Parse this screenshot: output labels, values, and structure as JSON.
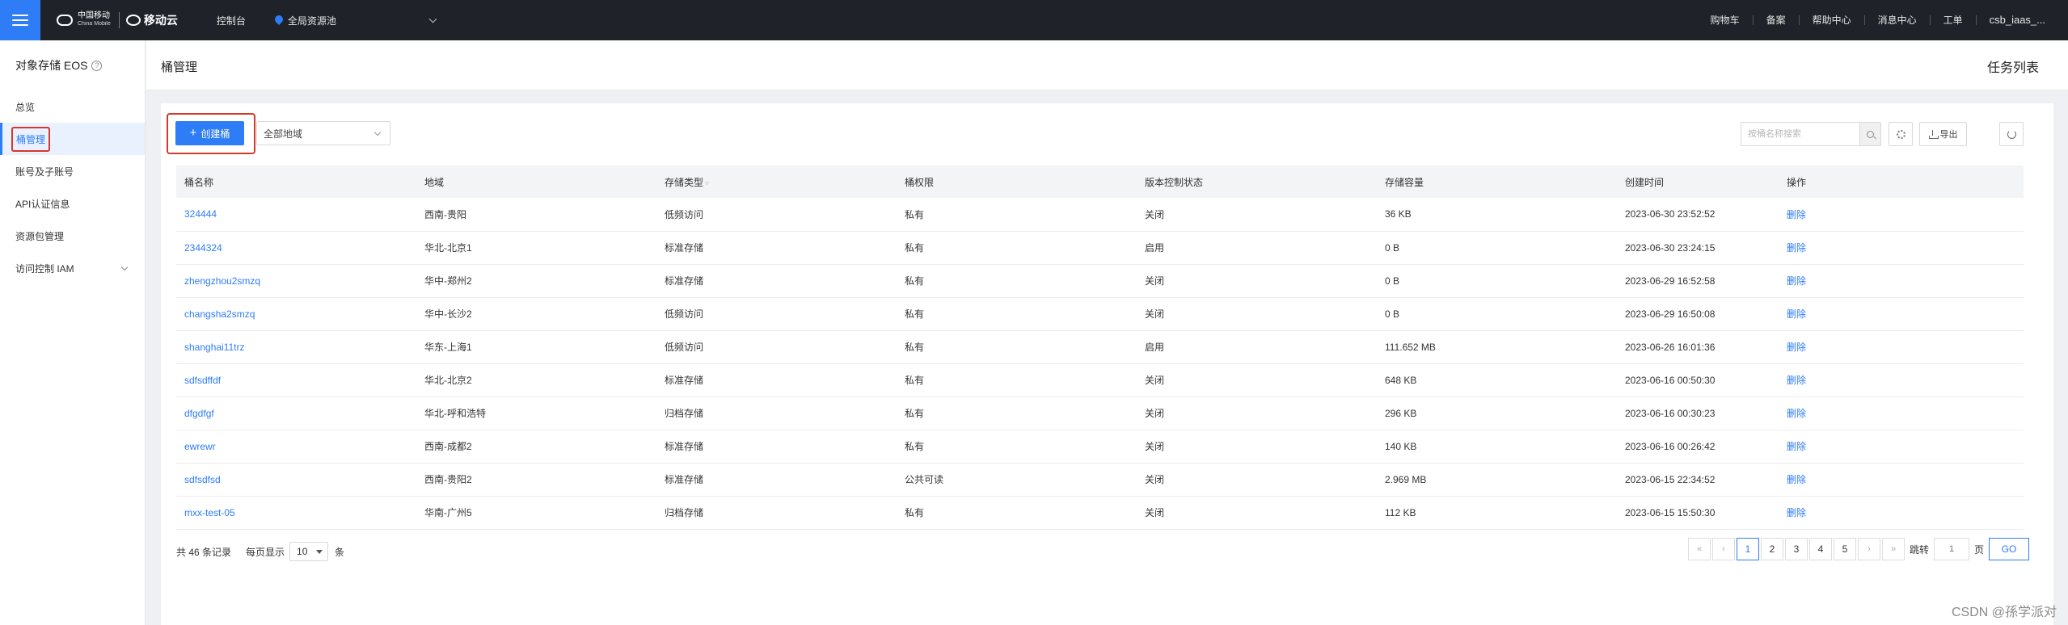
{
  "topbar": {
    "logo_cm": "中国移动",
    "logo_cm_en": "China Mobile",
    "logo_cloud": "移动云",
    "console": "控制台",
    "region": "全局资源池",
    "links": [
      "购物车",
      "备案",
      "帮助中心",
      "消息中心",
      "工单"
    ],
    "user": "csb_iaas_..."
  },
  "sidebar": {
    "title": "对象存储 EOS",
    "help": "?",
    "items": [
      {
        "label": "总览"
      },
      {
        "label": "桶管理"
      },
      {
        "label": "账号及子账号"
      },
      {
        "label": "API认证信息"
      },
      {
        "label": "资源包管理"
      },
      {
        "label": "访问控制 IAM"
      }
    ]
  },
  "header": {
    "title": "桶管理",
    "task_list": "任务列表"
  },
  "toolbar": {
    "create_plus": "+",
    "create_label": "创建桶",
    "region_filter": "全部地域",
    "search_placeholder": "按桶名称搜索",
    "export_label": "导出"
  },
  "table": {
    "columns": [
      "桶名称",
      "地域",
      "存储类型",
      "桶权限",
      "版本控制状态",
      "存储容量",
      "创建时间",
      "操作"
    ],
    "sort_marker": "÷",
    "rows": [
      {
        "name": "324444",
        "region": "西南-贵阳",
        "storage": "低频访问",
        "acl": "私有",
        "versioning": "关闭",
        "size": "36 KB",
        "created": "2023-06-30 23:52:52",
        "op": "删除"
      },
      {
        "name": "2344324",
        "region": "华北-北京1",
        "storage": "标准存储",
        "acl": "私有",
        "versioning": "启用",
        "size": "0 B",
        "created": "2023-06-30 23:24:15",
        "op": "删除"
      },
      {
        "name": "zhengzhou2smzq",
        "region": "华中-郑州2",
        "storage": "标准存储",
        "acl": "私有",
        "versioning": "关闭",
        "size": "0 B",
        "created": "2023-06-29 16:52:58",
        "op": "删除"
      },
      {
        "name": "changsha2smzq",
        "region": "华中-长沙2",
        "storage": "低频访问",
        "acl": "私有",
        "versioning": "关闭",
        "size": "0 B",
        "created": "2023-06-29 16:50:08",
        "op": "删除"
      },
      {
        "name": "shanghai11trz",
        "region": "华东-上海1",
        "storage": "低频访问",
        "acl": "私有",
        "versioning": "启用",
        "size": "111.652 MB",
        "created": "2023-06-26 16:01:36",
        "op": "删除"
      },
      {
        "name": "sdfsdffdf",
        "region": "华北-北京2",
        "storage": "标准存储",
        "acl": "私有",
        "versioning": "关闭",
        "size": "648 KB",
        "created": "2023-06-16 00:50:30",
        "op": "删除"
      },
      {
        "name": "dfgdfgf",
        "region": "华北-呼和浩特",
        "storage": "归档存储",
        "acl": "私有",
        "versioning": "关闭",
        "size": "296 KB",
        "created": "2023-06-16 00:30:23",
        "op": "删除"
      },
      {
        "name": "ewrewr",
        "region": "西南-成都2",
        "storage": "标准存储",
        "acl": "私有",
        "versioning": "关闭",
        "size": "140 KB",
        "created": "2023-06-16 00:26:42",
        "op": "删除"
      },
      {
        "name": "sdfsdfsd",
        "region": "西南-贵阳2",
        "storage": "标准存储",
        "acl": "公共可读",
        "versioning": "关闭",
        "size": "2.969 MB",
        "created": "2023-06-15 22:34:52",
        "op": "删除"
      },
      {
        "name": "mxx-test-05",
        "region": "华南-广州5",
        "storage": "归档存储",
        "acl": "私有",
        "versioning": "关闭",
        "size": "112 KB",
        "created": "2023-06-15 15:50:30",
        "op": "删除"
      }
    ]
  },
  "pagination": {
    "total": "共 46 条记录",
    "per_page_label": "每页显示",
    "per_page": "10",
    "per_page_unit": "条",
    "first": "«",
    "prev": "‹",
    "pages": [
      "1",
      "2",
      "3",
      "4",
      "5"
    ],
    "next": "›",
    "last": "»",
    "jump_label": "跳转",
    "jump_placeholder": "1",
    "page_unit": "页",
    "go": "GO"
  },
  "watermark": "CSDN @孫学派对",
  "colors": {
    "accent": "#2e7cf6",
    "highlight_box": "#d23a2a",
    "topbar": "#1f2329"
  }
}
